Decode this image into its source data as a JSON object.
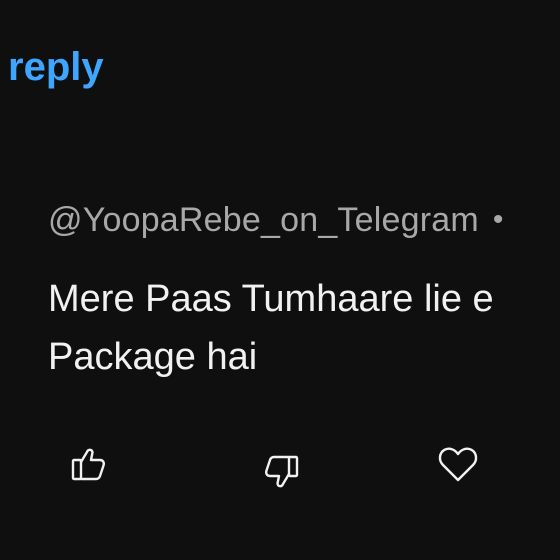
{
  "reply_link": {
    "label": "reply"
  },
  "comment": {
    "author": "@YoopaRebe_on_Telegram",
    "separator": "•",
    "text_line1": "Mere Paas Tumhaare lie e",
    "text_line2": "Package hai"
  },
  "actions": {
    "like_icon": "thumbs-up-icon",
    "dislike_icon": "thumbs-down-icon",
    "heart_icon": "heart-icon"
  },
  "colors": {
    "background": "#0f0f0f",
    "link": "#3ea6ff",
    "secondary_text": "#a8a8a8",
    "primary_text": "#f1f1f1"
  }
}
